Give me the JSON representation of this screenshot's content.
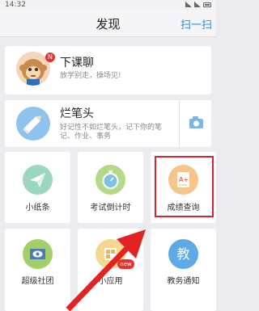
{
  "status": {
    "time": "14:32"
  },
  "header": {
    "title": "发现",
    "action": "扫一扫"
  },
  "chat_card": {
    "title": "下课聊",
    "subtitle": "放学别走，操场见!",
    "badge": "N"
  },
  "notes_card": {
    "title": "烂笔头",
    "subtitle_line1": "好记性不如烂笔头，记下你的笔",
    "subtitle_line2": "记、作业、事务"
  },
  "tiles": [
    {
      "label": "小纸条",
      "icon": "paper-plane-icon"
    },
    {
      "label": "考试倒计时",
      "icon": "stopwatch-icon"
    },
    {
      "label": "成绩查询",
      "icon": "grade-report-icon"
    },
    {
      "label": "超级社团",
      "icon": "club-flag-icon"
    },
    {
      "label": "小应用",
      "icon": "mini-app-icon",
      "badge": "new"
    },
    {
      "label": "教务通知",
      "icon": "notice-icon",
      "glyph": "教"
    }
  ],
  "colors": {
    "accent": "#2b8bde",
    "highlight": "#d9262e",
    "arrow": "#e32322"
  }
}
